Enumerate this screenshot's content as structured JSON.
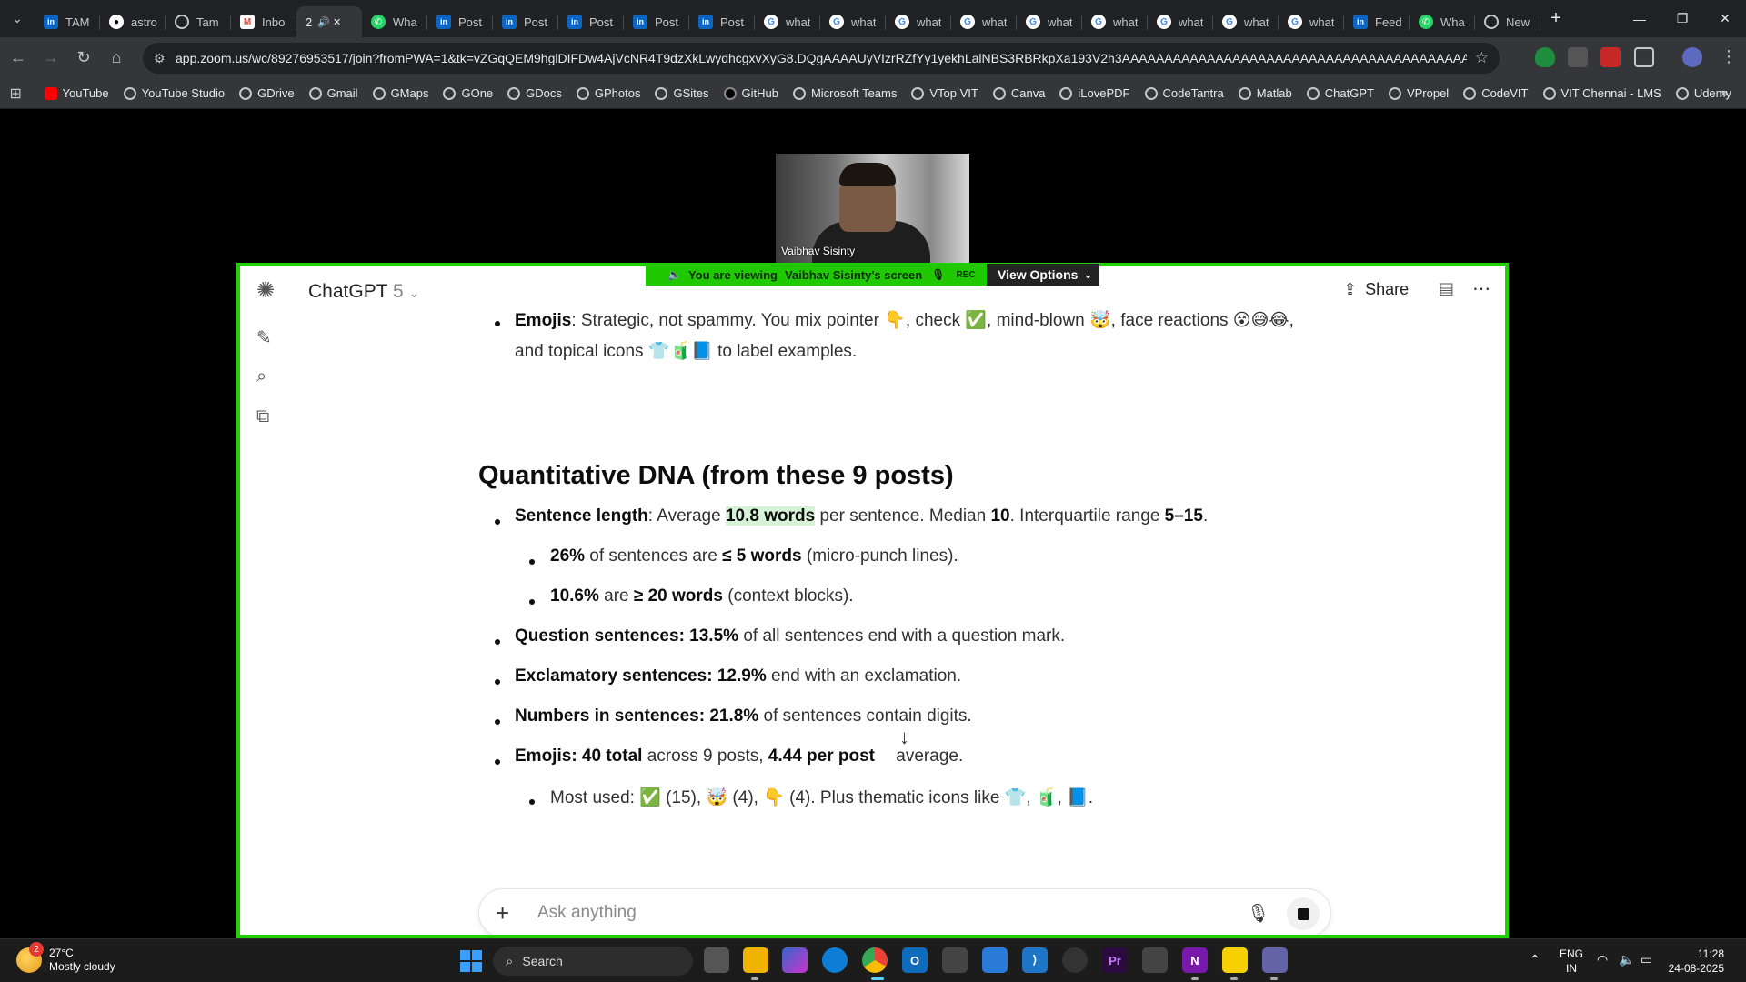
{
  "browser": {
    "tabs": [
      {
        "title": "TAM",
        "icon": "linkedin"
      },
      {
        "title": "astro",
        "icon": "github"
      },
      {
        "title": "Tam",
        "icon": "chrome"
      },
      {
        "title": "Inbo",
        "icon": "gmail"
      },
      {
        "title": "2",
        "icon": "audio",
        "active": true
      },
      {
        "title": "Wha",
        "icon": "whatsapp"
      },
      {
        "title": "Post",
        "icon": "linkedin"
      },
      {
        "title": "Post",
        "icon": "linkedin"
      },
      {
        "title": "Post",
        "icon": "linkedin"
      },
      {
        "title": "Post",
        "icon": "linkedin"
      },
      {
        "title": "Post",
        "icon": "linkedin"
      },
      {
        "title": "what",
        "icon": "google"
      },
      {
        "title": "what",
        "icon": "google"
      },
      {
        "title": "what",
        "icon": "google"
      },
      {
        "title": "what",
        "icon": "google"
      },
      {
        "title": "what",
        "icon": "google"
      },
      {
        "title": "what",
        "icon": "google"
      },
      {
        "title": "what",
        "icon": "google"
      },
      {
        "title": "what",
        "icon": "google"
      },
      {
        "title": "what",
        "icon": "google"
      },
      {
        "title": "Feed",
        "icon": "linkedin"
      },
      {
        "title": "Wha",
        "icon": "whatsapp"
      },
      {
        "title": "New",
        "icon": "chrome"
      }
    ],
    "url": "app.zoom.us/wc/89276953517/join?fromPWA=1&tk=vZGqQEM9hglDIFDw4AjVcNR4T9dzXkLwydhcgxvXyG8.DQgAAAAUyVIzrRZfYy1yekhLalNBS3RBRkpXa193V2h3AAAAAAAAAAAAAAAAAAAAAAAAAAAAAAAAAAAAAAAAAA&_x_zm_r...",
    "bookmarks": [
      "YouTube",
      "YouTube Studio",
      "GDrive",
      "Gmail",
      "GMaps",
      "GOne",
      "GDocs",
      "GPhotos",
      "GSites",
      "GitHub",
      "Microsoft Teams",
      "VTop VIT",
      "Canva",
      "iLovePDF",
      "CodeTantra",
      "Matlab",
      "ChatGPT",
      "VPropel",
      "CodeVIT",
      "VIT Chennai - LMS",
      "Udemy"
    ]
  },
  "zoom": {
    "participant_name": "Vaibhav Sisinty",
    "banner_prefix": "You are viewing",
    "banner_screen": "Vaibhav Sisinty's screen",
    "rec_label": "REC",
    "view_options": "View Options"
  },
  "chatgpt": {
    "title": "ChatGPT",
    "version": "5",
    "share_label": "Share",
    "composer_placeholder": "Ask anything",
    "heading": "Quantitative DNA (from these 9 posts)",
    "emojis_line1_label": "Emojis",
    "emojis_line1_text": ": Strategic, not spammy. You mix pointer 👇, check ✅, mind-blown 🤯, face reactions 😵😅😂,",
    "emojis_line2_text": "and topical icons 👕🧃📘 to label examples.",
    "sentence_label": "Sentence length",
    "sentence_pre": ": Average ",
    "sentence_highlight": "10.8 words",
    "sentence_post": " per sentence. Median ",
    "median": "10",
    "iqr_pre": ". Interquartile range ",
    "iqr": "5–15",
    "sub1_bold": "26%",
    "sub1_mid": " of sentences are ",
    "sub1_bold2": "≤ 5 words",
    "sub1_post": " (micro-punch lines).",
    "sub2_bold": "10.6%",
    "sub2_mid": " are ",
    "sub2_bold2": "≥ 20 words",
    "sub2_post": " (context blocks).",
    "q_label": "Question sentences",
    "q_value": "13.5%",
    "q_post": " of all sentences end with a question mark.",
    "ex_label": "Exclamatory sentences",
    "ex_value": "12.9%",
    "ex_post": " end with an exclamation.",
    "num_label": "Numbers in sentences",
    "num_value": "21.8%",
    "num_post": " of sentences contain digits.",
    "emo_label": "Emojis",
    "emo_total": "40 total",
    "emo_mid": " across 9 posts, ",
    "emo_per": "4.44 per post",
    "emo_post": " average.",
    "most_used": "Most used: ✅ (15), 🤯 (4), 👇 (4). Plus thematic icons like 👕, 🧃, 📘."
  },
  "taskbar": {
    "weather_temp": "27°C",
    "weather_desc": "Mostly cloudy",
    "weather_badge": "2",
    "search_label": "Search",
    "lang1": "ENG",
    "lang2": "IN",
    "time": "11:28",
    "date": "24-08-2025"
  }
}
